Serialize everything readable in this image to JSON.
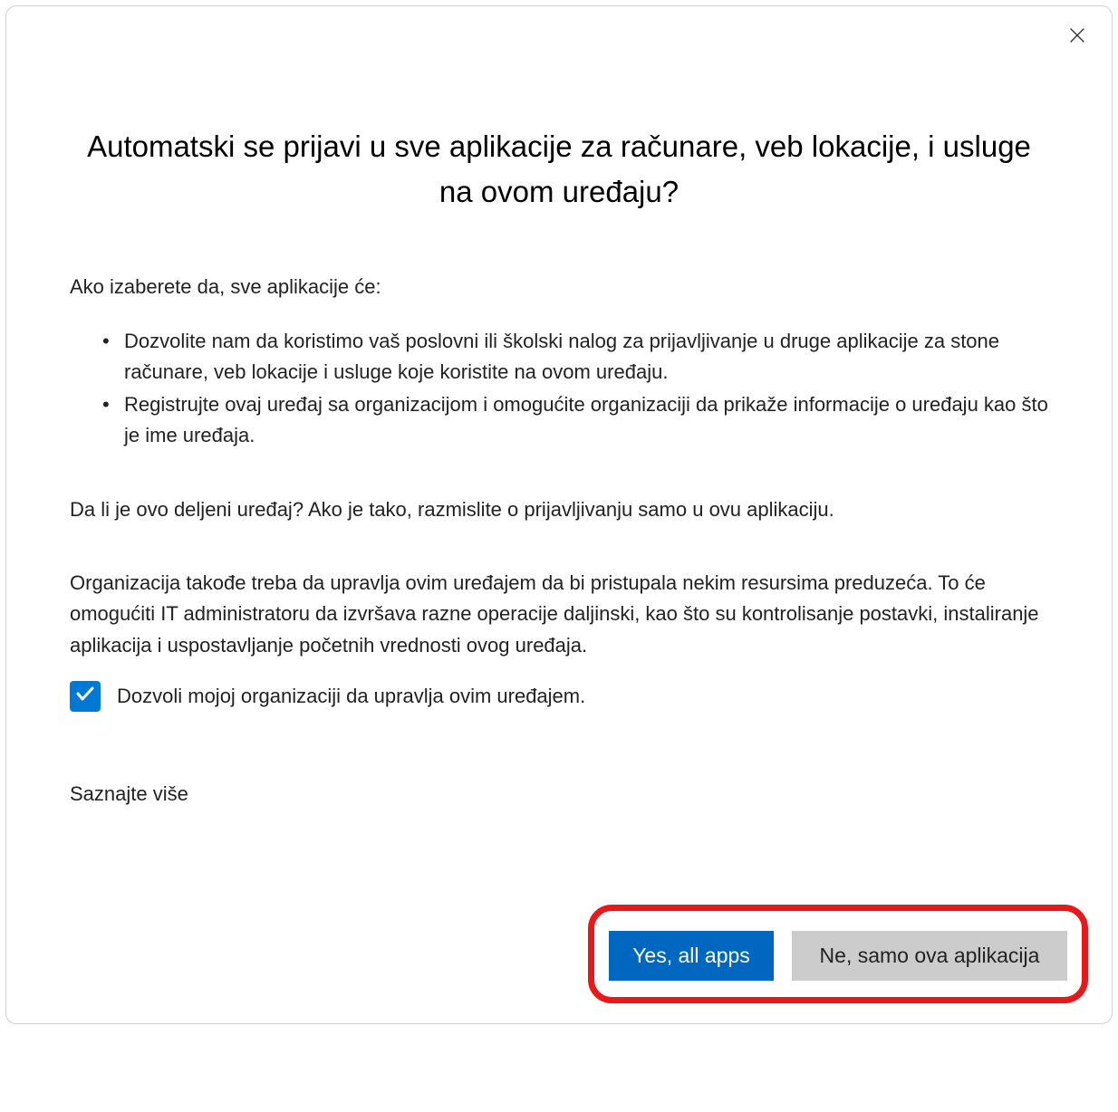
{
  "dialog": {
    "title": "Automatski se prijavi u sve aplikacije za računare, veb lokacije, i usluge na ovom uređaju?",
    "intro": "Ako izaberete da, sve aplikacije će:",
    "bullets": [
      "Dozvolite nam da koristimo vaš poslovni ili školski nalog za prijavljivanje u druge aplikacije za stone računare, veb lokacije i usluge koje koristite na ovom uređaju.",
      "Registrujte ovaj uređaj sa organizacijom i omogućite organizaciji da prikaže informacije o uređaju kao što je ime uređaja."
    ],
    "shared_device": "Da li je ovo deljeni uređaj? Ako je tako, razmislite o prijavljivanju samo u ovu aplikaciju.",
    "org_manage": "Organizacija takođe treba da upravlja ovim uređajem da bi pristupala nekim resursima preduzeća. To će omogućiti IT administratoru da izvršava razne operacije daljinski, kao što su kontrolisanje postavki, instaliranje aplikacija i uspostavljanje početnih vrednosti ovog uređaja.",
    "checkbox_label": "Dozvoli mojoj organizaciji da upravlja ovim uređajem.",
    "checkbox_checked": true,
    "learn_more": "Saznajte više",
    "buttons": {
      "yes": "Yes, all apps",
      "no": "Ne, samo ova aplikacija"
    }
  }
}
